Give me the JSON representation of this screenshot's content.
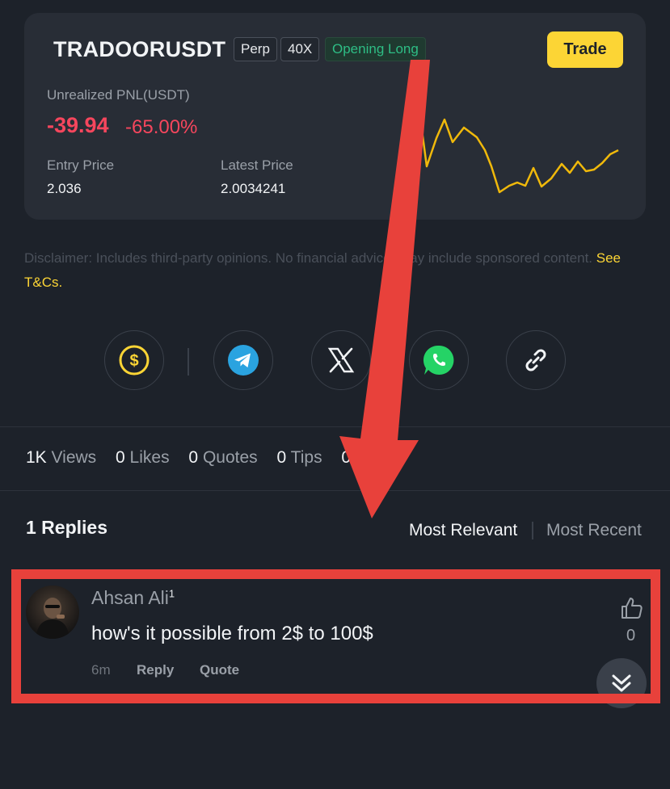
{
  "position": {
    "symbol": "TRADOORUSDT",
    "type_tag": "Perp",
    "leverage_tag": "40X",
    "direction_tag": "Opening Long",
    "trade_button": "Trade",
    "pnl_label": "Unrealized PNL(USDT)",
    "pnl_value": "-39.94",
    "pnl_percent": "-65.00%",
    "entry_label": "Entry Price",
    "entry_value": "2.036",
    "latest_label": "Latest Price",
    "latest_value": "2.0034241"
  },
  "disclaimer": {
    "text": "Disclaimer: Includes third-party opinions. No financial advice. May include sponsored content. ",
    "link": "See T&Cs."
  },
  "share_icons": [
    "dollar-tip-icon",
    "telegram-icon",
    "x-icon",
    "whatsapp-icon",
    "link-icon"
  ],
  "stats": {
    "views_num": "1K",
    "views_label": "Views",
    "likes_num": "0",
    "likes_label": "Likes",
    "quotes_num": "0",
    "quotes_label": "Quotes",
    "tips_num": "0",
    "tips_label": "Tips",
    "shares_num": "0",
    "shares_label": "S"
  },
  "replies": {
    "title": "1 Replies",
    "sort_relevant": "Most Relevant",
    "sort_recent": "Most Recent"
  },
  "reply": {
    "author": "Ahsan Ali",
    "badge": "1",
    "comment": "how's it possible from 2$ to 100$",
    "time": "6m",
    "reply_label": "Reply",
    "quote_label": "Quote",
    "like_count": "0"
  },
  "colors": {
    "background": "#1d222a",
    "card": "#282d36",
    "accent_yellow": "#fcd535",
    "loss_red": "#f6465d",
    "long_green": "#2ebd85",
    "annotation_red": "#e8413b"
  }
}
